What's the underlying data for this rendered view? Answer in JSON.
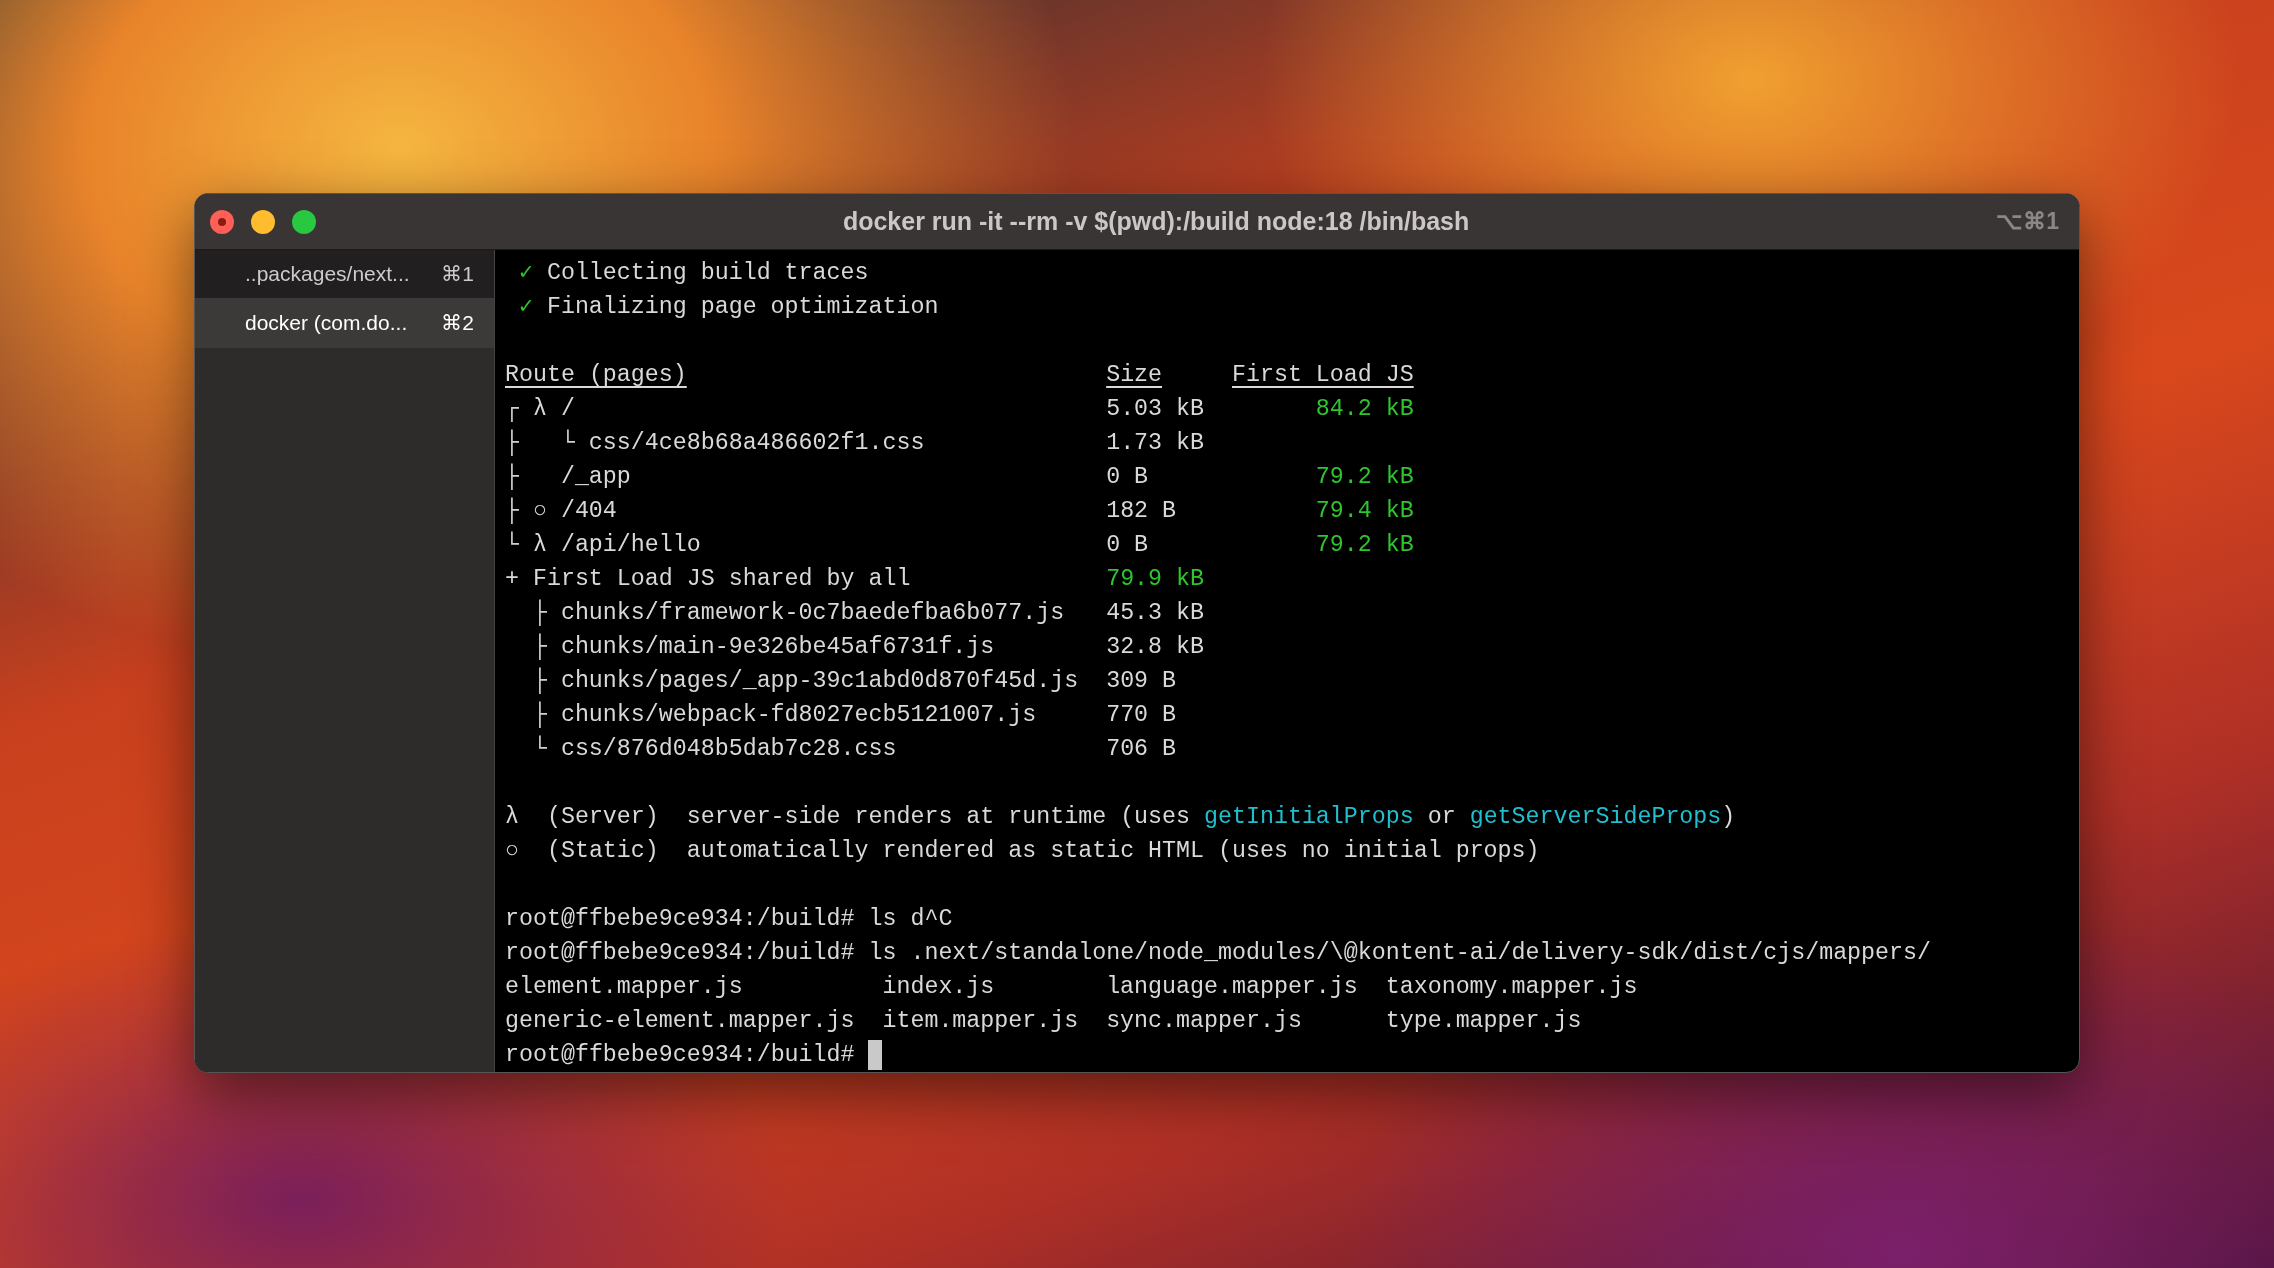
{
  "window": {
    "title": "docker run -it --rm -v $(pwd):/build node:18 /bin/bash",
    "shortcut": "⌥⌘1"
  },
  "tabs": [
    {
      "label": "..packages/next...",
      "shortcut": "⌘1",
      "selected": false
    },
    {
      "label": "docker (com.do...",
      "shortcut": "⌘2",
      "selected": true
    }
  ],
  "terminal": {
    "status_lines": [
      {
        "mark": "✓",
        "text": "Collecting build traces"
      },
      {
        "mark": "✓",
        "text": "Finalizing page optimization"
      }
    ],
    "route_table": {
      "columns": [
        "Route (pages)",
        "Size",
        "First Load JS"
      ],
      "rows": [
        {
          "branch": "┌",
          "symbol": "λ",
          "path": "/",
          "size": "5.03 kB",
          "first_load": "84.2 kB",
          "children": [
            {
              "branch": "├",
              "sub_branch": "└",
              "path": "css/4ce8b68a486602f1.css",
              "size": "1.73 kB"
            }
          ]
        },
        {
          "branch": "├",
          "path": "/_app",
          "size": "0 B",
          "first_load": "79.2 kB"
        },
        {
          "branch": "├",
          "symbol": "○",
          "path": "/404",
          "size": "182 B",
          "first_load": "79.4 kB"
        },
        {
          "branch": "└",
          "symbol": "λ",
          "path": "/api/hello",
          "size": "0 B",
          "first_load": "79.2 kB"
        }
      ],
      "shared": {
        "branch": "+",
        "label": "First Load JS shared by all",
        "size": "79.9 kB",
        "children": [
          {
            "branch": "├",
            "path": "chunks/framework-0c7baedefba6b077.js",
            "size": "45.3 kB"
          },
          {
            "branch": "├",
            "path": "chunks/main-9e326be45af6731f.js",
            "size": "32.8 kB"
          },
          {
            "branch": "├",
            "path": "chunks/pages/_app-39c1abd0d870f45d.js",
            "size": "309 B"
          },
          {
            "branch": "├",
            "path": "chunks/webpack-fd8027ecb5121007.js",
            "size": "770 B"
          },
          {
            "branch": "└",
            "path": "css/876d048b5dab7c28.css",
            "size": "706 B"
          }
        ]
      }
    },
    "legend": [
      {
        "symbol": "λ",
        "name": "(Server)",
        "description": [
          {
            "kind": "plain",
            "text": "server-side renders at runtime (uses "
          },
          {
            "kind": "code",
            "text": "getInitialProps"
          },
          {
            "kind": "plain",
            "text": " or "
          },
          {
            "kind": "code",
            "text": "getServerSideProps"
          },
          {
            "kind": "plain",
            "text": ")"
          }
        ]
      },
      {
        "symbol": "○",
        "name": "(Static)",
        "description": [
          {
            "kind": "plain",
            "text": "automatically rendered as static HTML (uses no initial props)"
          }
        ]
      }
    ],
    "commands": [
      {
        "prompt": "root@ffbebe9ce934:/build#",
        "command": "ls d^C"
      },
      {
        "prompt": "root@ffbebe9ce934:/build#",
        "command": "ls .next/standalone/node_modules/\\@kontent-ai/delivery-sdk/dist/cjs/mappers/"
      }
    ],
    "ls_output": [
      [
        "element.mapper.js",
        "index.js",
        "language.mapper.js",
        "taxonomy.mapper.js"
      ],
      [
        "generic-element.mapper.js",
        "item.mapper.js",
        "sync.mapper.js",
        "type.mapper.js"
      ]
    ],
    "current_prompt": "root@ffbebe9ce934:/build#"
  }
}
